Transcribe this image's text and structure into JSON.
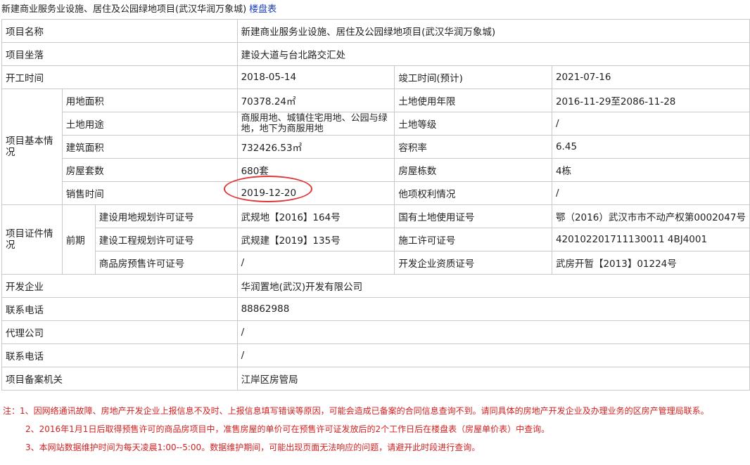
{
  "header": {
    "title": "新建商业服务业设施、居住及公园绿地项目(武汉华润万象城)",
    "link_label": "楼盘表"
  },
  "table": {
    "project_name_label": "项目名称",
    "project_name": "新建商业服务业设施、居住及公园绿地项目(武汉华润万象城)",
    "location_label": "项目坐落",
    "location": "建设大道与台北路交汇处",
    "start_label": "开工时间",
    "start": "2018-05-14",
    "finish_label": "竣工时间(预计)",
    "finish": "2021-07-16",
    "basic_label": "项目基本情况",
    "land_area_label": "用地面积",
    "land_area": "70378.24㎡",
    "land_term_label": "土地使用年限",
    "land_term": "2016-11-29至2086-11-28",
    "land_use_label": "土地用途",
    "land_use": "商服用地、城镇住宅用地、公园与绿地，地下为商服用地",
    "land_grade_label": "土地等级",
    "land_grade": "/",
    "build_area_label": "建筑面积",
    "build_area": "732426.53㎡",
    "far_label": "容积率",
    "far": "6.45",
    "units_label": "房屋套数",
    "units": "680套",
    "buildings_label": "房屋栋数",
    "buildings": "4栋",
    "sale_time_label": "销售时间",
    "sale_time": "2019-12-20",
    "other_rights_label": "他项权利情况",
    "other_rights": "/",
    "cert_label": "项目证件情况",
    "pre_label": "前期",
    "land_plan_label": "建设用地规划许可证号",
    "land_plan": "武规地【2016】164号",
    "state_land_label": "国有土地使用证号",
    "state_land": "鄂（2016）武汉市市不动产权第0002047号",
    "eng_plan_label": "建设工程规划许可证号",
    "eng_plan": "武规建【2019】135号",
    "construct_label": "施工许可证号",
    "construct": "420102201711130011 4BJ4001",
    "presale_label": "商品房预售许可证号",
    "presale": "/",
    "qual_label": "开发企业资质证号",
    "qual": "武房开暂【2013】01224号",
    "developer_label": "开发企业",
    "developer": "华润置地(武汉)开发有限公司",
    "phone1_label": "联系电话",
    "phone1": "88862988",
    "agent_label": "代理公司",
    "agent": "/",
    "phone2_label": "联系电话",
    "phone2": "/",
    "filing_label": "项目备案机关",
    "filing": "江岸区房管局"
  },
  "notes": [
    "注：1、因网络通讯故障、房地产开发企业上报信息不及时、上报信息填写错误等原因，可能会造成已备案的合同信息查询不到。请同具体的房地产开发企业及办理业务的区房产管理局联系。",
    "2、2016年1月1日后取得预售许可的商品房项目中，准售房屋的单价可在预售许可证发放后的2个工作日后在楼盘表（房屋单价表）中查询。",
    "3、本网站数据维护时间为每天凌晨1:00--5:00。数据维护期间，可能出现页面无法响应的问题，请避开此时段进行查询。"
  ],
  "colors": {
    "border": "#c9c9c9",
    "link": "#1a3fbf",
    "note": "#d21f1f",
    "annotation_circle": "#e03535"
  }
}
